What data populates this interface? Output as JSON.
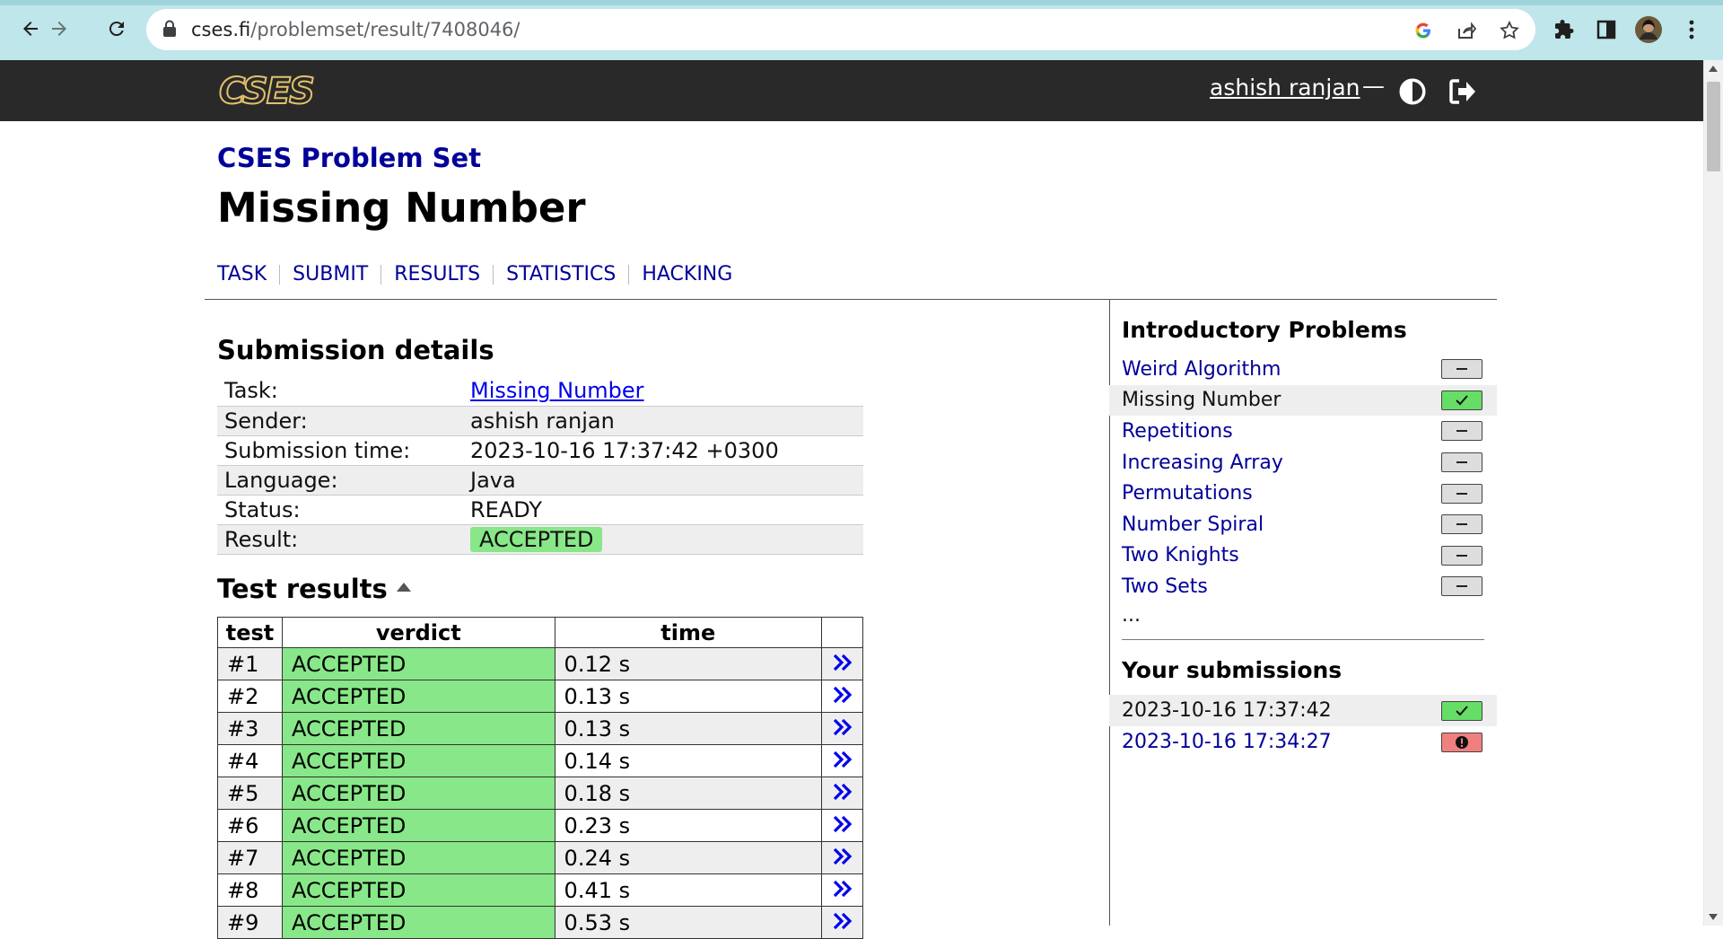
{
  "browser": {
    "url_host": "cses.fi",
    "url_path": "/problemset/result/7408046/",
    "icons": [
      "back-arrow-icon",
      "forward-arrow-icon",
      "reload-icon",
      "lock-icon",
      "google-icon",
      "share-icon",
      "star-icon",
      "extensions-icon",
      "side-panel-icon",
      "avatar",
      "more-vert-icon"
    ]
  },
  "header": {
    "logo_text": "CSES",
    "user": "ashish ranjan",
    "separator": "—"
  },
  "page": {
    "problem_set": "CSES Problem Set",
    "title": "Missing Number",
    "tabs": [
      "TASK",
      "SUBMIT",
      "RESULTS",
      "STATISTICS",
      "HACKING"
    ]
  },
  "submission": {
    "heading": "Submission details",
    "rows": [
      {
        "key": "Task:",
        "value": "Missing Number"
      },
      {
        "key": "Sender:",
        "value": "ashish ranjan"
      },
      {
        "key": "Submission time:",
        "value": "2023-10-16 17:37:42 +0300"
      },
      {
        "key": "Language:",
        "value": "Java"
      },
      {
        "key": "Status:",
        "value": "READY"
      },
      {
        "key": "Result:",
        "value": "ACCEPTED"
      }
    ]
  },
  "tests": {
    "heading": "Test results",
    "columns": [
      "test",
      "verdict",
      "time"
    ],
    "rows": [
      {
        "test": "#1",
        "verdict": "ACCEPTED",
        "time": "0.12 s"
      },
      {
        "test": "#2",
        "verdict": "ACCEPTED",
        "time": "0.13 s"
      },
      {
        "test": "#3",
        "verdict": "ACCEPTED",
        "time": "0.13 s"
      },
      {
        "test": "#4",
        "verdict": "ACCEPTED",
        "time": "0.14 s"
      },
      {
        "test": "#5",
        "verdict": "ACCEPTED",
        "time": "0.18 s"
      },
      {
        "test": "#6",
        "verdict": "ACCEPTED",
        "time": "0.23 s"
      },
      {
        "test": "#7",
        "verdict": "ACCEPTED",
        "time": "0.24 s"
      },
      {
        "test": "#8",
        "verdict": "ACCEPTED",
        "time": "0.41 s"
      },
      {
        "test": "#9",
        "verdict": "ACCEPTED",
        "time": "0.53 s"
      }
    ]
  },
  "sidebar": {
    "heading": "Introductory Problems",
    "problems": [
      {
        "name": "Weird Algorithm",
        "status": "none"
      },
      {
        "name": "Missing Number",
        "status": "ok"
      },
      {
        "name": "Repetitions",
        "status": "none"
      },
      {
        "name": "Increasing Array",
        "status": "none"
      },
      {
        "name": "Permutations",
        "status": "none"
      },
      {
        "name": "Number Spiral",
        "status": "none"
      },
      {
        "name": "Two Knights",
        "status": "none"
      },
      {
        "name": "Two Sets",
        "status": "none"
      }
    ],
    "ellipsis": "...",
    "submissions_heading": "Your submissions",
    "submissions": [
      {
        "time": "2023-10-16 17:37:42",
        "status": "ok"
      },
      {
        "time": "2023-10-16 17:34:27",
        "status": "fail"
      }
    ]
  },
  "colors": {
    "accepted": "#88e788",
    "link": "#000099",
    "header_bg": "#292929",
    "fail": "#f08080"
  }
}
